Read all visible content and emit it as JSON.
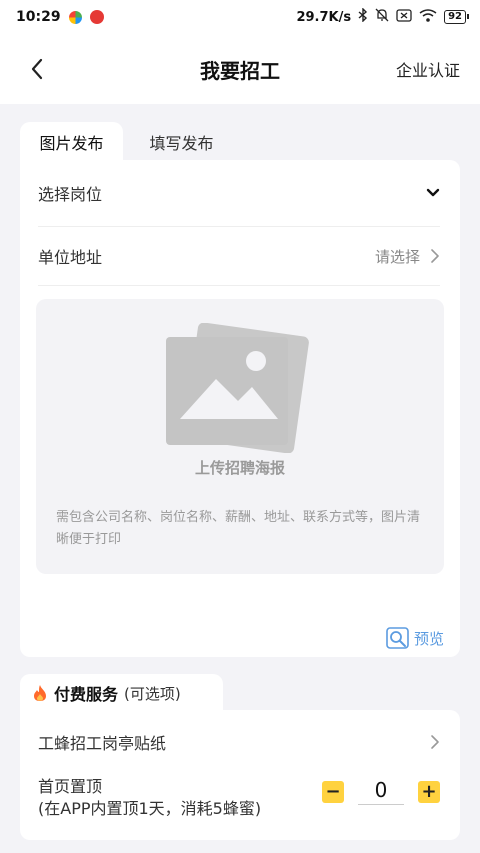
{
  "status_bar": {
    "time": "10:29",
    "speed": "29.7K/s",
    "battery": "92"
  },
  "navbar": {
    "title": "我要招工",
    "action": "企业认证"
  },
  "tabs": [
    {
      "label": "图片发布",
      "active": true
    },
    {
      "label": "填写发布",
      "active": false
    }
  ],
  "form": {
    "position_label": "选择岗位",
    "address_label": "单位地址",
    "address_placeholder": "请选择"
  },
  "upload": {
    "label": "上传招聘海报",
    "hint": "需包含公司名称、岗位名称、薪酬、地址、联系方式等，图片清晰便于打印"
  },
  "preview_label": "预览",
  "paid": {
    "title": "付费服务",
    "subtitle": "(可选项)",
    "sticker_label": "工蜂招工岗亭贴纸",
    "top_label": "首页置顶",
    "top_desc": "(在APP内置顶1天，消耗5蜂蜜)",
    "top_value": "0",
    "minus": "−",
    "plus": "+"
  },
  "colors": {
    "accent_yellow": "#ffd23f",
    "link_blue": "#5b9be0",
    "fire_orange": "#ff6a2b"
  }
}
